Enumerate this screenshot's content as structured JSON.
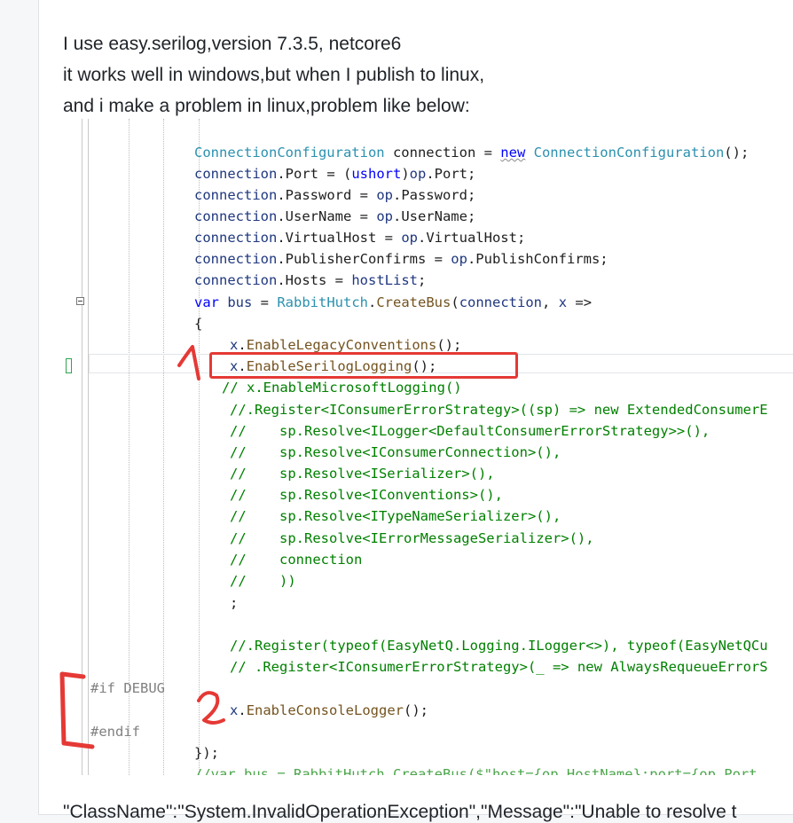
{
  "post": {
    "paragraph_lines": [
      "I use easy.serilog,version 7.3.5, netcore6",
      "it works well in windows,but when I publish to linux,",
      "and i make a problem in linux,problem like below:"
    ],
    "bottom_cutoff_text": "\"ClassName\":\"System.InvalidOperationException\",\"Message\":\"Unable to resolve t"
  },
  "code": {
    "l1": {
      "a": "ConnectionConfiguration",
      "b": " connection = ",
      "c": "new",
      "d": " ",
      "e": "ConnectionConfiguration",
      "f": "();"
    },
    "l2": {
      "a": "connection",
      "b": ".Port = (",
      "c": "ushort",
      "d": ")",
      "e": "op",
      "f": ".Port;"
    },
    "l3": {
      "a": "connection",
      "b": ".Password = ",
      "c": "op",
      "d": ".Password;"
    },
    "l4": {
      "a": "connection",
      "b": ".UserName = ",
      "c": "op",
      "d": ".UserName;"
    },
    "l5": {
      "a": "connection",
      "b": ".VirtualHost = ",
      "c": "op",
      "d": ".VirtualHost;"
    },
    "l6": {
      "a": "connection",
      "b": ".PublisherConfirms = ",
      "c": "op",
      "d": ".PublishConfirms;"
    },
    "l7": {
      "a": "connection",
      "b": ".Hosts = ",
      "c": "hostList",
      "d": ";"
    },
    "l8": {
      "a": "var",
      "b": " ",
      "c": "bus",
      "d": " = ",
      "e": "RabbitHutch",
      "f": ".",
      "g": "CreateBus",
      "h": "(",
      "i": "connection",
      "j": ", ",
      "k": "x",
      "l": " =>"
    },
    "l9": "{",
    "l10": {
      "a": "x",
      "b": ".",
      "c": "EnableLegacyConventions",
      "d": "();"
    },
    "l11": {
      "a": "x",
      "b": ".",
      "c": "EnableSerilogLogging",
      "d": "();"
    },
    "l12": "// x.EnableMicrosoftLogging()",
    "l13": "//.Register<IConsumerErrorStrategy>((sp) => new ExtendedConsumerE",
    "l14": "//    sp.Resolve<ILogger<DefaultConsumerErrorStrategy>>(),",
    "l15": "//    sp.Resolve<IConsumerConnection>(),",
    "l16": "//    sp.Resolve<ISerializer>(),",
    "l17": "//    sp.Resolve<IConventions>(),",
    "l18": "//    sp.Resolve<ITypeNameSerializer>(),",
    "l19": "//    sp.Resolve<IErrorMessageSerializer>(),",
    "l20": "//    connection",
    "l21": "//    ))",
    "l22": ";",
    "l23": "//.Register(typeof(EasyNetQ.Logging.ILogger<>), typeof(EasyNetQCu",
    "l24": "// .Register<IConsumerErrorStrategy>(_ => new AlwaysRequeueErrorS",
    "l25": "#if DEBUG",
    "l26": {
      "a": "x",
      "b": ".",
      "c": "EnableConsoleLogger",
      "d": "();"
    },
    "l27": "#endif",
    "l28": "});",
    "l29": "//var bus = RabbitHutch.CreateBus($\"host={op.HostName};port={op.Port"
  },
  "colors": {
    "annotation_red": "#e53935",
    "keyword_blue": "#0000ff",
    "type_teal": "#2b91af",
    "comment_green": "#008000"
  }
}
